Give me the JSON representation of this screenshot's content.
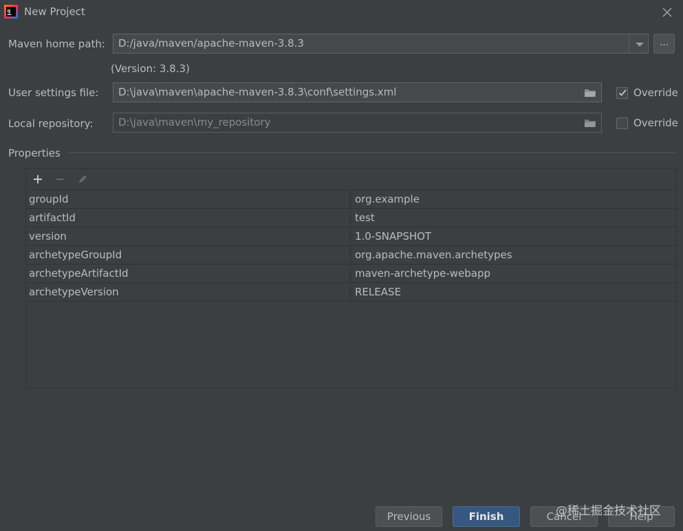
{
  "window": {
    "title": "New Project",
    "icon": "intellij-idea-icon"
  },
  "maven_home": {
    "label": "Maven home path:",
    "value": "D:/java/maven/apache-maven-3.8.3",
    "version_text": "(Version: 3.8.3)",
    "browse_label": "..."
  },
  "user_settings": {
    "label": "User settings file:",
    "value": "D:\\java\\maven\\apache-maven-3.8.3\\conf\\settings.xml",
    "override_label": "Override",
    "override_checked": true
  },
  "local_repository": {
    "label": "Local repository:",
    "value": "D:\\java\\maven\\my_repository",
    "override_label": "Override",
    "override_checked": false
  },
  "properties": {
    "title": "Properties",
    "toolbar": [
      "add-icon",
      "remove-icon",
      "edit-icon"
    ],
    "rows": [
      {
        "key": "groupId",
        "value": "org.example"
      },
      {
        "key": "artifactId",
        "value": "test"
      },
      {
        "key": "version",
        "value": "1.0-SNAPSHOT"
      },
      {
        "key": "archetypeGroupId",
        "value": "org.apache.maven.archetypes"
      },
      {
        "key": "archetypeArtifactId",
        "value": "maven-archetype-webapp"
      },
      {
        "key": "archetypeVersion",
        "value": "RELEASE"
      }
    ]
  },
  "buttons": {
    "previous": "Previous",
    "finish": "Finish",
    "cancel": "Cancel",
    "help": "Help"
  },
  "watermark": "@稀土掘金技术社区",
  "colors": {
    "background": "#3c3f41",
    "field": "#45494a",
    "default_button": "#365880",
    "text": "#bbbbbb"
  }
}
